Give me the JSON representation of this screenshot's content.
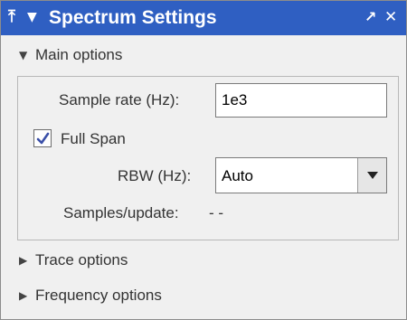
{
  "window": {
    "title": "Spectrum Settings",
    "title_bar_color": "#2f5fc2",
    "icons": {
      "pin": "pin-icon",
      "menu": "dropdown-menu-icon",
      "undock": "undock-arrow-icon",
      "close": "close-icon"
    },
    "pin_glyph": "⤒",
    "menu_glyph": "▼",
    "undock_glyph": "↗",
    "close_glyph": "✕"
  },
  "sections": {
    "main": {
      "label": "Main options",
      "expanded": true,
      "glyph": "▼"
    },
    "trace": {
      "label": "Trace options",
      "expanded": false,
      "glyph": "▶"
    },
    "frequency": {
      "label": "Frequency options",
      "expanded": false,
      "glyph": "▶"
    }
  },
  "main_options": {
    "sample_rate_label": "Sample rate (Hz):",
    "sample_rate_value": "1e3",
    "full_span_label": "Full Span",
    "full_span_checked": true,
    "rbw_label": "RBW (Hz):",
    "rbw_value": "Auto",
    "samples_update_label": "Samples/update:",
    "samples_update_value": "- -"
  }
}
